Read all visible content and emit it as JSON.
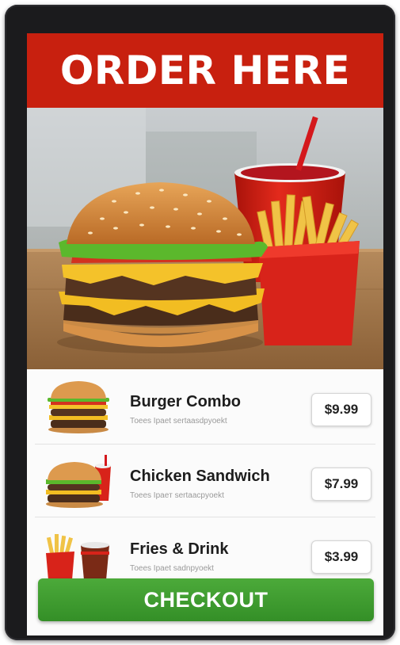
{
  "header": {
    "title": "ORDER HERE"
  },
  "hero": {
    "image": "burger-fries-drink-photo"
  },
  "menu": {
    "items": [
      {
        "name": "Burger Combo",
        "description": "Тоees Ipaet sertaasdрyoekt",
        "price": "$9.99",
        "thumb": "burger-thumb"
      },
      {
        "name": "Chicken Sandwich",
        "description": "Тоeеs Ipaeт sertaacpyoekt",
        "price": "$7.99",
        "thumb": "sandwich-thumb"
      },
      {
        "name": "Fries & Drink",
        "description": "Тоees Ipaet sadnpyoekt",
        "price": "$3.99",
        "thumb": "fries-drink-thumb"
      }
    ]
  },
  "checkout": {
    "label": "CHECKOUT"
  },
  "colors": {
    "header_red": "#c8200f",
    "checkout_green": "#3c9b2f",
    "bezel": "#1b1b1d"
  }
}
